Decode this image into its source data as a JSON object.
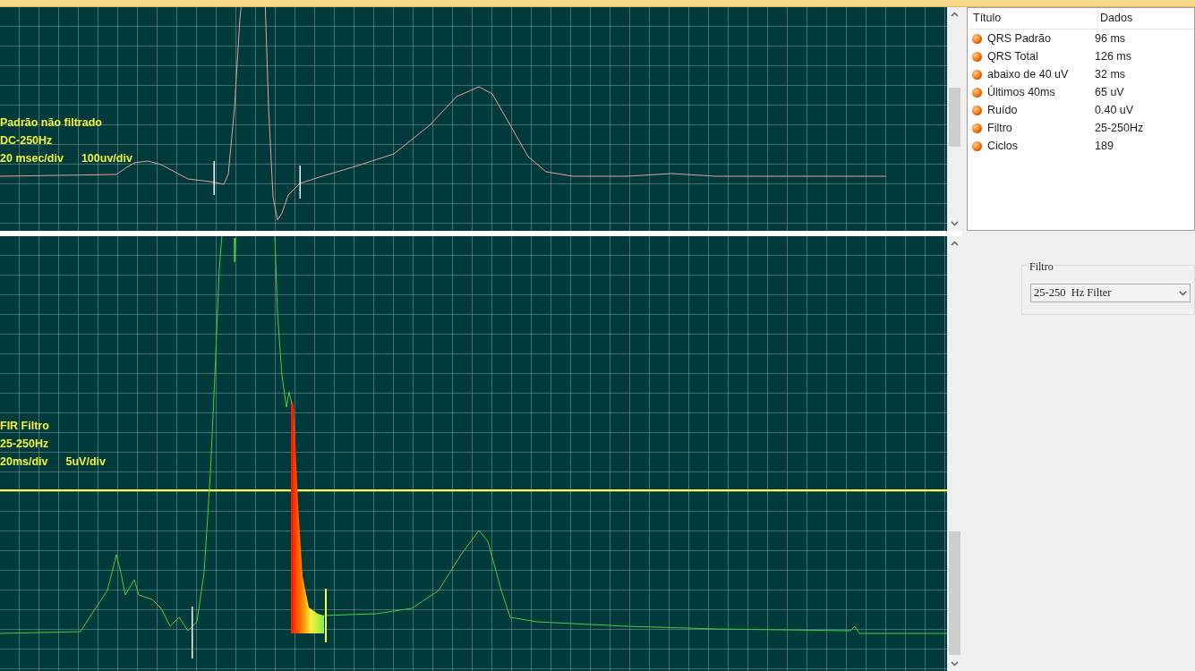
{
  "charts": [
    {
      "labels": [
        "Padrão não filtrado",
        "DC-250Hz",
        "20 msec/div",
        "100uv/div"
      ]
    },
    {
      "labels": [
        "FIR Filtro",
        "25-250Hz",
        "20ms/div",
        "5uV/div"
      ]
    }
  ],
  "table": {
    "columns": [
      "Título",
      "Dados"
    ],
    "rows": [
      {
        "title": "QRS Padrão",
        "value": "96 ms"
      },
      {
        "title": "QRS Total",
        "value": "126 ms"
      },
      {
        "title": "abaixo de 40 uV",
        "value": "32 ms"
      },
      {
        "title": "Últimos 40ms",
        "value": "65 uV"
      },
      {
        "title": "Ruído",
        "value": "0.40 uV"
      },
      {
        "title": "Filtro",
        "value": "25-250Hz"
      },
      {
        "title": "Ciclos",
        "value": "189"
      }
    ]
  },
  "filter_group": {
    "title": "Filtro",
    "value": "25-250  Hz Filter"
  }
}
